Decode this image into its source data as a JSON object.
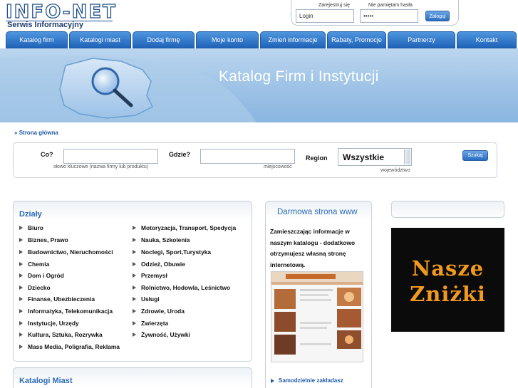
{
  "logo": {
    "name": "INFO-NET",
    "subtitle": "Serwis Informacyjny"
  },
  "login": {
    "register_label": "Zarejestruj się",
    "forgot_label": "Nie pamiętam hasła",
    "login_value": "Login",
    "password_value": "•••••",
    "submit_label": "Zaloguj"
  },
  "nav": [
    "Katalog firm",
    "Katalogi miast",
    "Dodaj firmę",
    "Moje konto",
    "Zmień informacje",
    "Rabaty, Promocje",
    "Partnerzy",
    "Kontakt"
  ],
  "banner": {
    "title": "Katalog Firm i Instytucji"
  },
  "breadcrumb": {
    "arrow": "»",
    "label": "Strona główna"
  },
  "search": {
    "what_label": "Co?",
    "what_hint": "słowo kluczowe (nazwa firmy lub produktu)",
    "where_label": "Gdzie?",
    "where_hint": "miejscowość",
    "region_label": "Region",
    "region_value": "Wszystkie",
    "region_hint": "województwo",
    "submit_label": "Szukaj"
  },
  "categories": {
    "title": "Działy",
    "left": [
      "Biuro",
      "Biznes, Prawo",
      "Budownictwo, Nieruchomości",
      "Chemia",
      "Dom i Ogród",
      "Dziecko",
      "Finanse, Ubezbieczenia",
      "Informatyka, Telekomunikacja",
      "Instytucje, Urzędy",
      "Kultura, Sztuka, Rozrywka",
      "Mass Media, Poligrafia, Reklama"
    ],
    "right": [
      "Motoryzacja, Transport, Spedycja",
      "Nauka, Szkolenia",
      "Noclegi, Sport,Turystyka",
      "Odzież, Obuwie",
      "Przemysł",
      "Rolnictwo, Hodowla, Leśnictwo",
      "Usługi",
      "Zdrowie, Uroda",
      "Zwierzęta",
      "Żywność, Używki"
    ]
  },
  "cities": {
    "title": "Katalogi Miast"
  },
  "promo": {
    "title": "Darmowa strona www",
    "text": "Zamieszczając informacje w naszym katalogu - dodatkowo otrzymujesz własną stronę internetową.",
    "link": "Samodzielnie zakładasz"
  },
  "discount": {
    "line1": "Nasze",
    "line2": "Zniżki"
  },
  "colors": {
    "nav": "#1f63b8",
    "accent": "#2c6cb8",
    "banner": "#9dc2e6",
    "discount_text": "#f29a1e"
  }
}
